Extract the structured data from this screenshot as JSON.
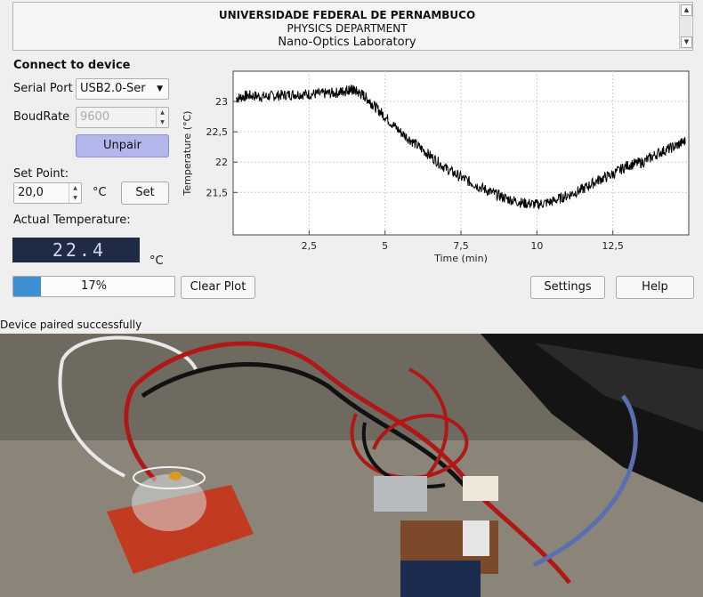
{
  "header": {
    "line1": "UNIVERSIDADE FEDERAL DE PERNAMBUCO",
    "line2": "PHYSICS DEPARTMENT",
    "line3": "Nano-Optics Laboratory"
  },
  "connect": {
    "title": "Connect to device",
    "serial_port_label": "Serial Port",
    "serial_port_value": "USB2.0-Ser",
    "baud_label": "BoudRate",
    "baud_value": "9600",
    "unpair_label": "Unpair"
  },
  "setpoint": {
    "label": "Set Point:",
    "value": "20,0",
    "unit": "°C",
    "set_label": "Set"
  },
  "actual": {
    "label": "Actual Temperature:",
    "value": "22.4",
    "unit": "°C"
  },
  "progress": {
    "value": 0.17,
    "text": "17%"
  },
  "buttons": {
    "clear_plot": "Clear Plot",
    "settings": "Settings",
    "help": "Help"
  },
  "status": "Device paired successfully",
  "colors": {
    "lcd_bg": "#1f2a45",
    "progress": "#3d91d3",
    "unpair": "#b3b6ea"
  },
  "chart_data": {
    "type": "line",
    "xlabel": "Time (min)",
    "ylabel": "Temperature (°C)",
    "xlim": [
      0,
      15
    ],
    "ylim": [
      20.8,
      23.5
    ],
    "xticks": [
      "2,5",
      "5",
      "7,5",
      "10",
      "12,5"
    ],
    "xtick_values": [
      2.5,
      5,
      7.5,
      10,
      12.5
    ],
    "yticks": [
      "21,5",
      "22",
      "22,5",
      "23"
    ],
    "ytick_values": [
      21.5,
      22,
      22.5,
      23
    ],
    "grid": true,
    "series": [
      {
        "x": [
          0.1,
          0.5,
          1.0,
          1.5,
          2.0,
          2.5,
          3.0,
          3.5,
          3.8,
          4.0,
          4.3,
          4.6,
          5.0,
          5.5,
          6.0,
          6.5,
          7.0,
          7.5,
          8.0,
          8.5,
          9.0,
          9.5,
          10.0,
          10.5,
          11.0,
          11.5,
          12.0,
          12.5,
          13.0,
          13.5,
          14.0,
          14.5,
          14.9
        ],
        "y": [
          23.05,
          23.1,
          23.08,
          23.1,
          23.12,
          23.12,
          23.13,
          23.15,
          23.2,
          23.18,
          23.1,
          22.95,
          22.75,
          22.5,
          22.3,
          22.1,
          21.9,
          21.75,
          21.62,
          21.5,
          21.4,
          21.33,
          21.3,
          21.35,
          21.45,
          21.55,
          21.7,
          21.8,
          21.95,
          22.0,
          22.15,
          22.25,
          22.35
        ]
      }
    ]
  }
}
